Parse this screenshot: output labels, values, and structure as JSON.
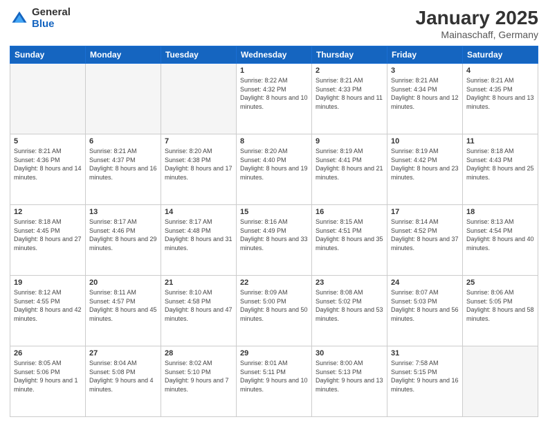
{
  "logo": {
    "general": "General",
    "blue": "Blue"
  },
  "title": {
    "month": "January 2025",
    "location": "Mainaschaff, Germany"
  },
  "days_of_week": [
    "Sunday",
    "Monday",
    "Tuesday",
    "Wednesday",
    "Thursday",
    "Friday",
    "Saturday"
  ],
  "weeks": [
    [
      {
        "day": "",
        "empty": true
      },
      {
        "day": "",
        "empty": true
      },
      {
        "day": "",
        "empty": true
      },
      {
        "day": "1",
        "sunrise": "8:22 AM",
        "sunset": "4:32 PM",
        "daylight": "8 hours and 10 minutes."
      },
      {
        "day": "2",
        "sunrise": "8:21 AM",
        "sunset": "4:33 PM",
        "daylight": "8 hours and 11 minutes."
      },
      {
        "day": "3",
        "sunrise": "8:21 AM",
        "sunset": "4:34 PM",
        "daylight": "8 hours and 12 minutes."
      },
      {
        "day": "4",
        "sunrise": "8:21 AM",
        "sunset": "4:35 PM",
        "daylight": "8 hours and 13 minutes."
      }
    ],
    [
      {
        "day": "5",
        "sunrise": "8:21 AM",
        "sunset": "4:36 PM",
        "daylight": "8 hours and 14 minutes."
      },
      {
        "day": "6",
        "sunrise": "8:21 AM",
        "sunset": "4:37 PM",
        "daylight": "8 hours and 16 minutes."
      },
      {
        "day": "7",
        "sunrise": "8:20 AM",
        "sunset": "4:38 PM",
        "daylight": "8 hours and 17 minutes."
      },
      {
        "day": "8",
        "sunrise": "8:20 AM",
        "sunset": "4:40 PM",
        "daylight": "8 hours and 19 minutes."
      },
      {
        "day": "9",
        "sunrise": "8:19 AM",
        "sunset": "4:41 PM",
        "daylight": "8 hours and 21 minutes."
      },
      {
        "day": "10",
        "sunrise": "8:19 AM",
        "sunset": "4:42 PM",
        "daylight": "8 hours and 23 minutes."
      },
      {
        "day": "11",
        "sunrise": "8:18 AM",
        "sunset": "4:43 PM",
        "daylight": "8 hours and 25 minutes."
      }
    ],
    [
      {
        "day": "12",
        "sunrise": "8:18 AM",
        "sunset": "4:45 PM",
        "daylight": "8 hours and 27 minutes."
      },
      {
        "day": "13",
        "sunrise": "8:17 AM",
        "sunset": "4:46 PM",
        "daylight": "8 hours and 29 minutes."
      },
      {
        "day": "14",
        "sunrise": "8:17 AM",
        "sunset": "4:48 PM",
        "daylight": "8 hours and 31 minutes."
      },
      {
        "day": "15",
        "sunrise": "8:16 AM",
        "sunset": "4:49 PM",
        "daylight": "8 hours and 33 minutes."
      },
      {
        "day": "16",
        "sunrise": "8:15 AM",
        "sunset": "4:51 PM",
        "daylight": "8 hours and 35 minutes."
      },
      {
        "day": "17",
        "sunrise": "8:14 AM",
        "sunset": "4:52 PM",
        "daylight": "8 hours and 37 minutes."
      },
      {
        "day": "18",
        "sunrise": "8:13 AM",
        "sunset": "4:54 PM",
        "daylight": "8 hours and 40 minutes."
      }
    ],
    [
      {
        "day": "19",
        "sunrise": "8:12 AM",
        "sunset": "4:55 PM",
        "daylight": "8 hours and 42 minutes."
      },
      {
        "day": "20",
        "sunrise": "8:11 AM",
        "sunset": "4:57 PM",
        "daylight": "8 hours and 45 minutes."
      },
      {
        "day": "21",
        "sunrise": "8:10 AM",
        "sunset": "4:58 PM",
        "daylight": "8 hours and 47 minutes."
      },
      {
        "day": "22",
        "sunrise": "8:09 AM",
        "sunset": "5:00 PM",
        "daylight": "8 hours and 50 minutes."
      },
      {
        "day": "23",
        "sunrise": "8:08 AM",
        "sunset": "5:02 PM",
        "daylight": "8 hours and 53 minutes."
      },
      {
        "day": "24",
        "sunrise": "8:07 AM",
        "sunset": "5:03 PM",
        "daylight": "8 hours and 56 minutes."
      },
      {
        "day": "25",
        "sunrise": "8:06 AM",
        "sunset": "5:05 PM",
        "daylight": "8 hours and 58 minutes."
      }
    ],
    [
      {
        "day": "26",
        "sunrise": "8:05 AM",
        "sunset": "5:06 PM",
        "daylight": "9 hours and 1 minute."
      },
      {
        "day": "27",
        "sunrise": "8:04 AM",
        "sunset": "5:08 PM",
        "daylight": "9 hours and 4 minutes."
      },
      {
        "day": "28",
        "sunrise": "8:02 AM",
        "sunset": "5:10 PM",
        "daylight": "9 hours and 7 minutes."
      },
      {
        "day": "29",
        "sunrise": "8:01 AM",
        "sunset": "5:11 PM",
        "daylight": "9 hours and 10 minutes."
      },
      {
        "day": "30",
        "sunrise": "8:00 AM",
        "sunset": "5:13 PM",
        "daylight": "9 hours and 13 minutes."
      },
      {
        "day": "31",
        "sunrise": "7:58 AM",
        "sunset": "5:15 PM",
        "daylight": "9 hours and 16 minutes."
      },
      {
        "day": "",
        "empty": true
      }
    ]
  ],
  "labels": {
    "sunrise": "Sunrise:",
    "sunset": "Sunset:",
    "daylight": "Daylight:"
  }
}
